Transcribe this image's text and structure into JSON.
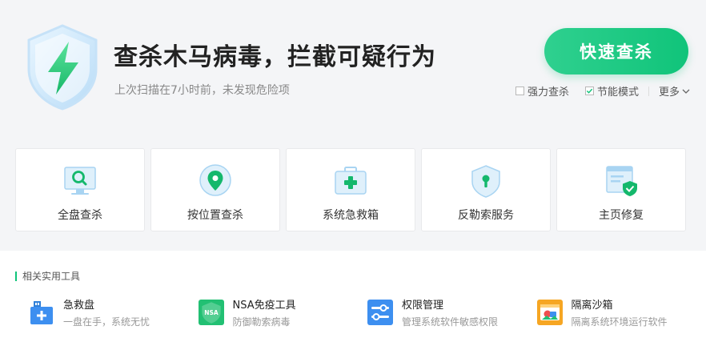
{
  "header": {
    "headline": "查杀木马病毒，拦截可疑行为",
    "subline": "上次扫描在7小时前，未发现危险项",
    "scan_button": "快速查杀",
    "options": {
      "strong_scan": {
        "label": "强力查杀",
        "checked": false
      },
      "power_save": {
        "label": "节能模式",
        "checked": true
      },
      "more": "更多"
    }
  },
  "cards": [
    {
      "label": "全盘查杀",
      "icon": "monitor-search-icon"
    },
    {
      "label": "按位置查杀",
      "icon": "location-pin-icon"
    },
    {
      "label": "系统急救箱",
      "icon": "first-aid-kit-icon"
    },
    {
      "label": "反勒索服务",
      "icon": "shield-lock-icon"
    },
    {
      "label": "主页修复",
      "icon": "homepage-repair-icon"
    }
  ],
  "tools_section": {
    "title": "相关实用工具",
    "items": [
      {
        "name": "急救盘",
        "desc": "一盘在手，系统无忧",
        "icon": "rescue-usb-icon"
      },
      {
        "name": "NSA免疫工具",
        "desc": "防御勒索病毒",
        "icon": "nsa-shield-icon",
        "badge": "NSA"
      },
      {
        "name": "权限管理",
        "desc": "管理系统软件敏感权限",
        "icon": "permission-sliders-icon"
      },
      {
        "name": "隔离沙箱",
        "desc": "隔离系统环境运行软件",
        "icon": "sandbox-icon"
      }
    ]
  },
  "colors": {
    "accent": "#10c47a",
    "blue": "#3d8ff0",
    "orange": "#f6a623"
  }
}
